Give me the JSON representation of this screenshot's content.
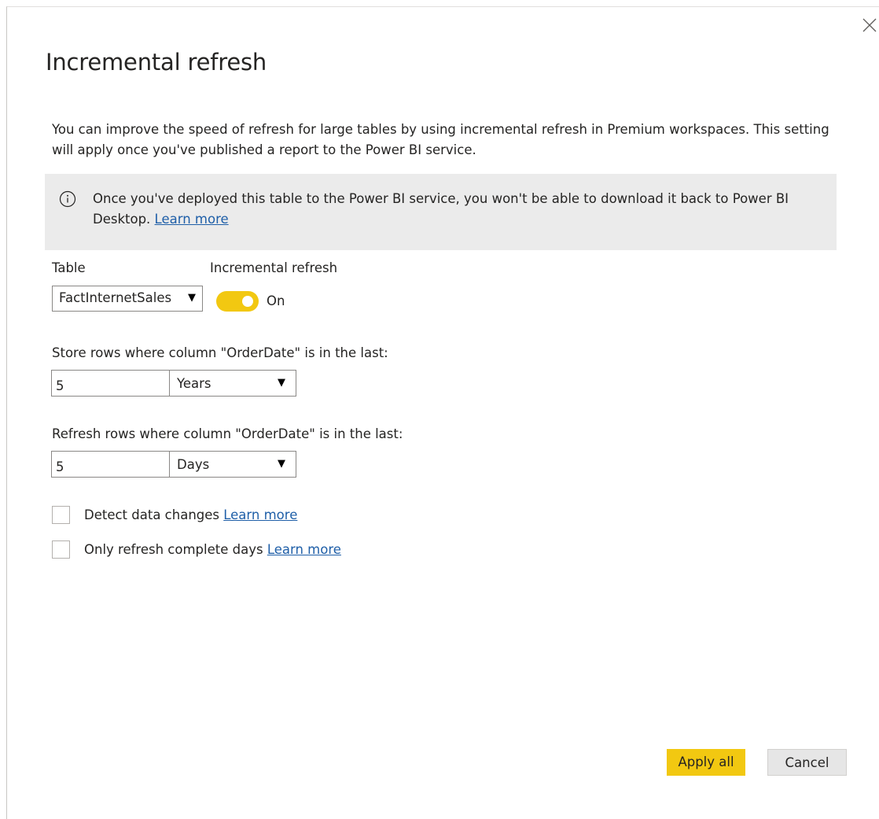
{
  "dialog": {
    "title": "Incremental refresh",
    "description": "You can improve the speed of refresh for large tables by using incremental refresh in Premium workspaces. This setting will apply once you've published a report to the Power BI service.",
    "close_icon": "close-icon"
  },
  "info_banner": {
    "icon": "info-icon",
    "text": "Once you've deployed this table to the Power BI service, you won't be able to download it back to Power BI Desktop.",
    "link": "Learn more"
  },
  "table": {
    "label": "Table",
    "selected": "FactInternetSales"
  },
  "incremental_refresh": {
    "label": "Incremental refresh",
    "state": "On",
    "enabled": true,
    "accent_color": "#f2c811"
  },
  "store_rows": {
    "label": "Store rows where column \"OrderDate\" is in the last:",
    "value": "5",
    "unit": "Years"
  },
  "refresh_rows": {
    "label": "Refresh rows where column \"OrderDate\" is in the last:",
    "value": "5",
    "unit": "Days"
  },
  "options": {
    "detect_changes": {
      "label": "Detect data changes",
      "link": "Learn more",
      "checked": false
    },
    "complete_days": {
      "label": "Only refresh complete days",
      "link": "Learn more",
      "checked": false
    }
  },
  "buttons": {
    "apply": "Apply all",
    "cancel": "Cancel"
  }
}
